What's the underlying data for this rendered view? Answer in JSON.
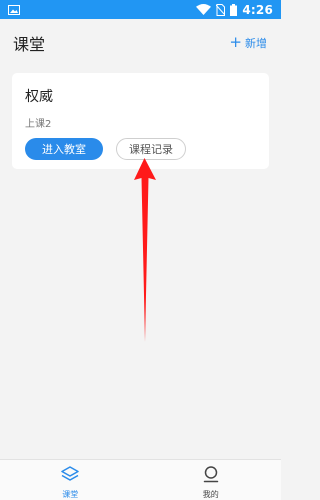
{
  "status_bar": {
    "time": "4:26",
    "background_color": "#2196f3",
    "left_icon": "image-icon",
    "right_icons": [
      "wifi-icon",
      "no-sim-icon",
      "battery-icon"
    ]
  },
  "header": {
    "title": "课堂",
    "add_label": "新增",
    "add_icon": "plus-icon",
    "accent_color": "#2a8bea"
  },
  "class_card": {
    "name": "权威",
    "subtitle": "上课2",
    "enter_button_label": "进入教室",
    "record_button_label": "课程记录"
  },
  "annotation": {
    "type": "red-arrow",
    "points_to": "record-button",
    "color": "#ff1a1a"
  },
  "tab_bar": {
    "tabs": [
      {
        "label": "课堂",
        "icon": "layers-icon",
        "active": true
      },
      {
        "label": "我的",
        "icon": "user-icon",
        "active": false
      }
    ]
  }
}
